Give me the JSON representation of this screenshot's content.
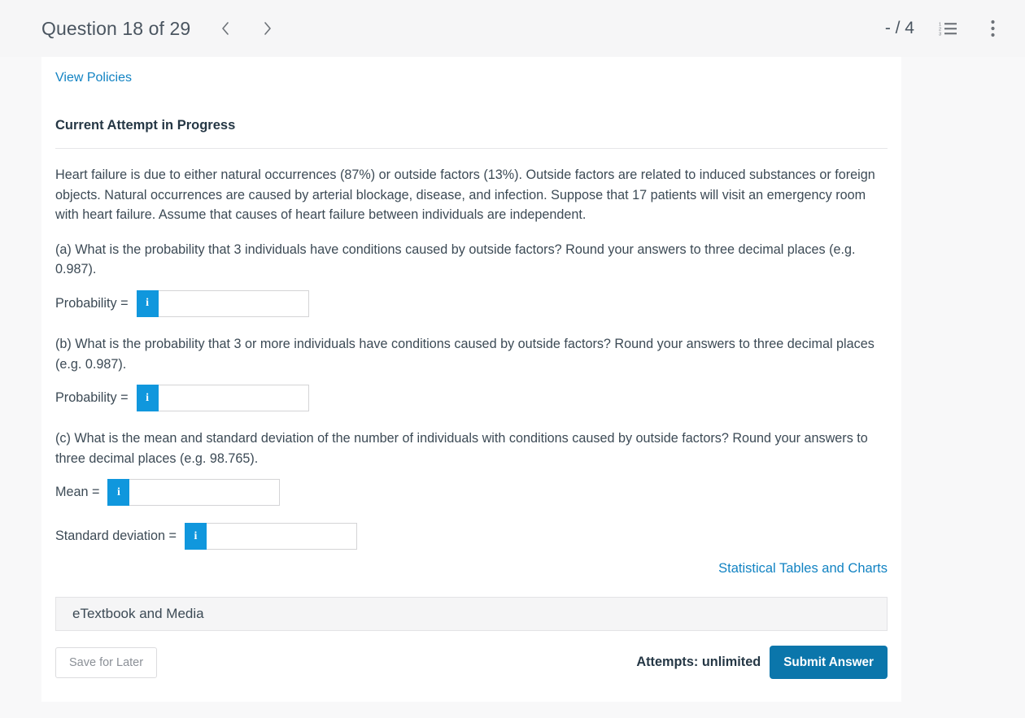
{
  "header": {
    "title": "Question 18 of 29",
    "prev_icon": "chevron-left-icon",
    "next_icon": "chevron-right-icon",
    "score": "- / 4",
    "list_icon": "numbered-list-icon",
    "menu_icon": "more-vertical-icon"
  },
  "card": {
    "policies_link": "View Policies",
    "attempt_status": "Current Attempt in Progress",
    "intro": "Heart failure is due to either natural occurrences (87%) or outside factors (13%). Outside factors are related to induced substances or foreign objects. Natural occurrences are caused by arterial blockage, disease, and infection. Suppose that 17 patients will visit an emergency room with heart failure. Assume that causes of heart failure between individuals are independent.",
    "part_a": "(a) What is the probability that 3 individuals have conditions caused by outside factors? Round your answers to three decimal places (e.g. 0.987).",
    "part_b": "(b) What is the probability that 3 or more individuals have conditions caused by outside factors? Round your answers to three decimal places (e.g. 0.987).",
    "part_c": "(c) What is the mean and standard deviation of the number of individuals with conditions caused by outside factors? Round your answers to three decimal places (e.g. 98.765).",
    "answers": [
      {
        "label": "Probability =",
        "value": "",
        "placeholder": "",
        "info_icon": "info-icon",
        "input_width": 185
      },
      {
        "label": "Probability =",
        "value": "",
        "placeholder": "",
        "info_icon": "info-icon",
        "input_width": 185
      },
      {
        "label": "Mean =",
        "value": "",
        "placeholder": "",
        "info_icon": "info-icon",
        "input_width": 185
      },
      {
        "label": "Standard deviation =",
        "value": "",
        "placeholder": "",
        "info_icon": "info-icon",
        "input_width": 185
      }
    ],
    "tables_link": "Statistical Tables and Charts",
    "etextbook_label": "eTextbook and Media"
  },
  "footer": {
    "save_label": "Save for Later",
    "attempts_label": "Attempts: unlimited",
    "submit_label": "Submit Answer"
  },
  "colors": {
    "link_blue": "#1283c3",
    "info_blue": "#1097dd",
    "submit_blue": "#0b76ab",
    "page_bg": "#f8f8f9",
    "card_bg": "#ffffff",
    "text": "#3c4a55"
  }
}
